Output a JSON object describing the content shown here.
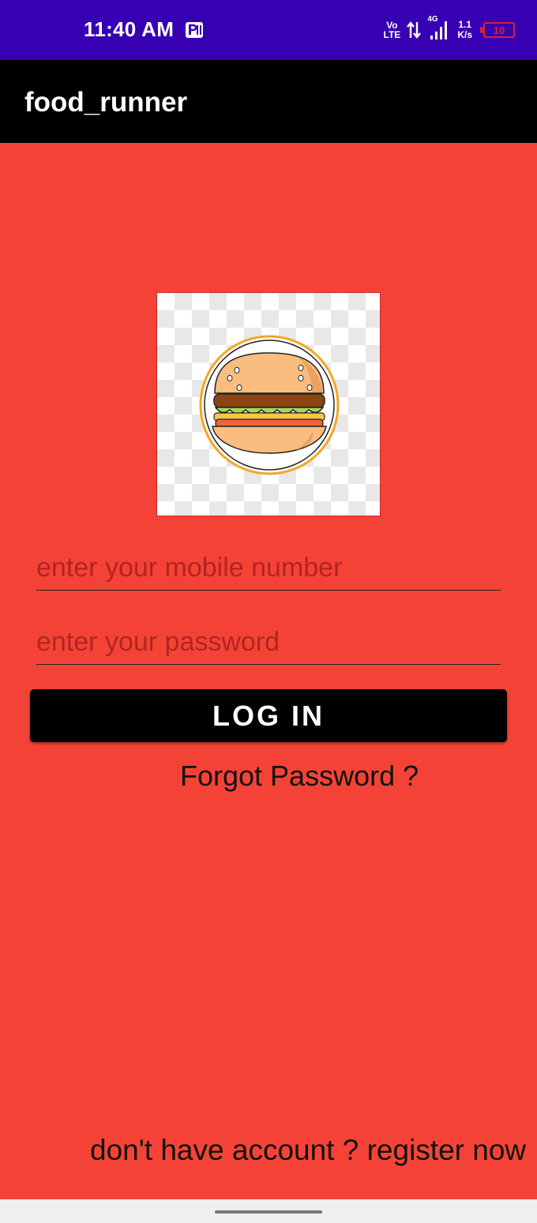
{
  "status_bar": {
    "time": "11:40 AM",
    "volte_top": "Vo",
    "volte_bottom": "LTE",
    "network": "4G",
    "speed_value": "1.1",
    "speed_unit": "K/s",
    "battery": "10",
    "icons": [
      "app-notification-icon",
      "volte-icon",
      "data-transfer-icon",
      "signal-icon",
      "battery-icon"
    ]
  },
  "app_bar": {
    "title": "food_runner"
  },
  "logo": {
    "name": "burger-logo",
    "accent": "#f5a623"
  },
  "form": {
    "mobile_placeholder": "enter your mobile number",
    "password_placeholder": "enter your password",
    "login_label": "LOG IN",
    "forgot_label": "Forgot Password ?"
  },
  "footer": {
    "register_label": "don't have account ? register now"
  },
  "colors": {
    "background": "#f44336",
    "status_bar": "#3700b3",
    "app_bar": "#000000",
    "button": "#000000"
  }
}
